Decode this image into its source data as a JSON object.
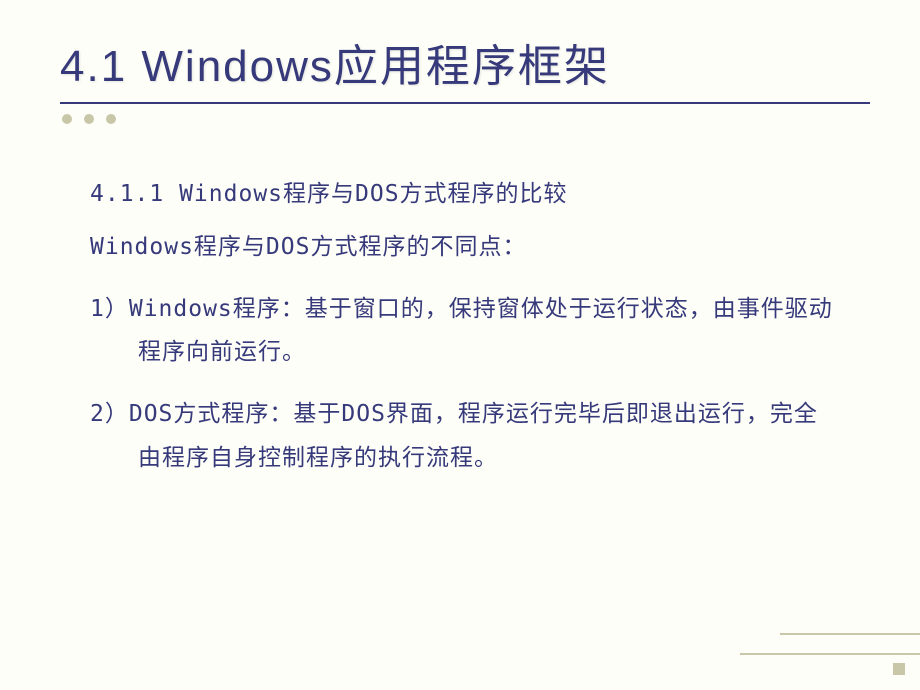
{
  "title": "4.1  Windows应用程序框架",
  "subtitle": "4.1.1  Windows程序与DOS方式程序的比较",
  "intro": "Windows程序与DOS方式程序的不同点：",
  "point1": "1）Windows程序：基于窗口的，保持窗体处于运行状态，由事件驱动程序向前运行。",
  "point2": "2）DOS方式程序：基于DOS界面，程序运行完毕后即退出运行，完全由程序自身控制程序的执行流程。"
}
